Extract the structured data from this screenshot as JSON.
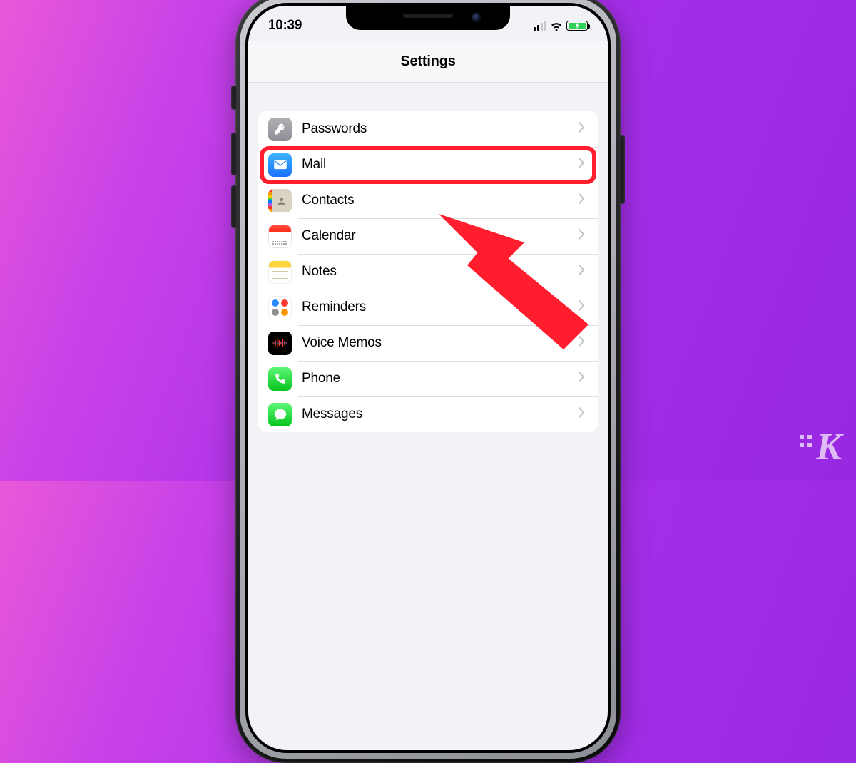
{
  "status": {
    "time": "10:39"
  },
  "header": {
    "title": "Settings"
  },
  "rows": [
    {
      "label": "Passwords"
    },
    {
      "label": "Mail"
    },
    {
      "label": "Contacts"
    },
    {
      "label": "Calendar"
    },
    {
      "label": "Notes"
    },
    {
      "label": "Reminders"
    },
    {
      "label": "Voice Memos"
    },
    {
      "label": "Phone"
    },
    {
      "label": "Messages"
    }
  ],
  "annotations": {
    "highlighted_row_index": 1
  }
}
